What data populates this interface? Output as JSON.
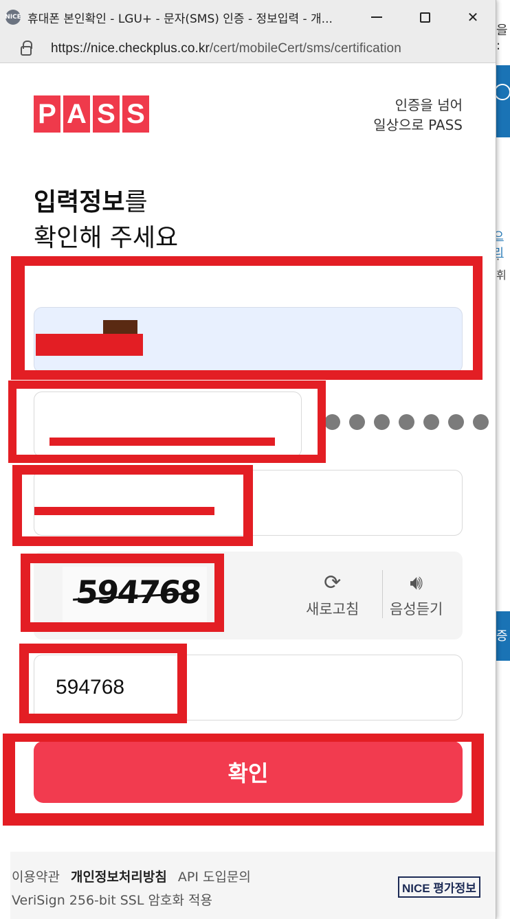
{
  "window": {
    "title": "휴대폰 본인확인 - LGU+ - 문자(SMS) 인증 - 정보입력 - 개...",
    "favicon_label": "NICE",
    "minimize_icon": "minimize-icon",
    "maximize_icon": "maximize-icon",
    "close_label": "✕",
    "url_host": "https://nice.checkplus.co.kr",
    "url_path": "/cert/mobileCert/sms/certification"
  },
  "background_page": {
    "text_top": "을 :",
    "text_link": "으리",
    "text_mid": "· 휘",
    "text_button": "증"
  },
  "header": {
    "logo_letters": [
      "P",
      "A",
      "S",
      "S"
    ],
    "slogan_line1": "인증을 넘어",
    "slogan_line2": "일상으로 PASS"
  },
  "heading": {
    "bold": "입력정보",
    "rest": "를",
    "line2": "확인해 주세요"
  },
  "form": {
    "name_value": "",
    "birth_value": "",
    "masked_digits": 7,
    "phone_value": "",
    "captcha_text": "594768",
    "refresh_label": "새로고침",
    "audio_label": "음성듣기",
    "captcha_input_value": "594768",
    "confirm_label": "확인"
  },
  "footer": {
    "terms": "이용약관",
    "privacy": "개인정보처리방침",
    "api": "API 도입문의",
    "ssl": "VeriSign 256-bit SSL 암호화 적용",
    "brand": "NICE 평가정보"
  },
  "colors": {
    "brand_red": "#ef3a4b",
    "confirm_red": "#f23b4f",
    "redaction_red": "#e31e24",
    "autofill_blue": "#e8f0fe",
    "background_accent": "#1a73b5"
  }
}
